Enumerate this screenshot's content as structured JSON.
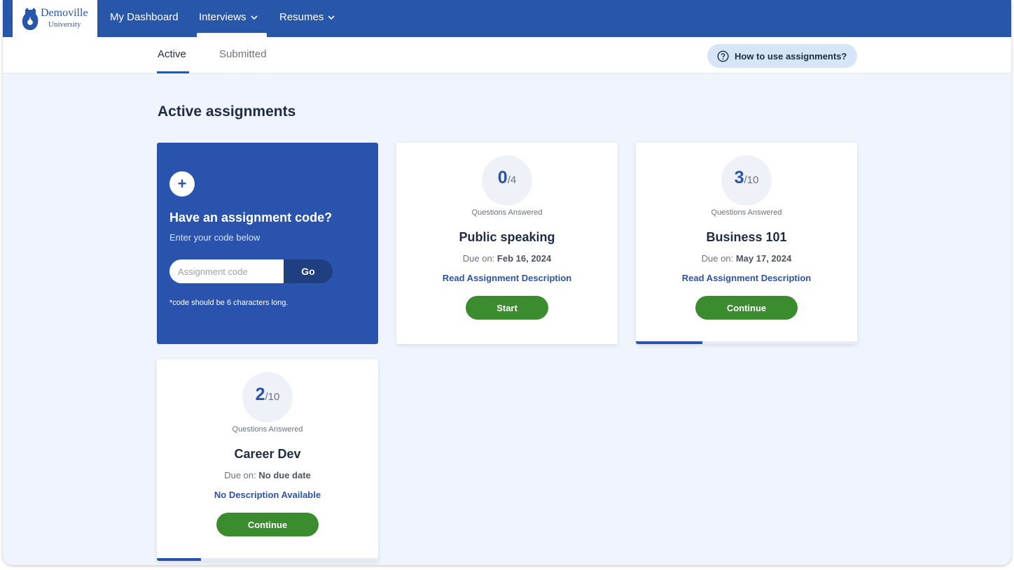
{
  "brand": {
    "name": "Demoville",
    "sub": "University",
    "color": "#2856a8"
  },
  "nav": {
    "dashboard": "My Dashboard",
    "interviews": "Interviews",
    "resumes": "Resumes"
  },
  "tabs": {
    "active": "Active",
    "submitted": "Submitted"
  },
  "help": {
    "label": "How to use assignments?",
    "icon": "question-circle-icon"
  },
  "page_title": "Active assignments",
  "code_card": {
    "title": "Have an assignment code?",
    "subtitle": "Enter your code below",
    "placeholder": "Assignment code",
    "value": "",
    "go_label": "Go",
    "hint": "*code should be 6 characters long.",
    "icon": "plus-icon"
  },
  "assignments": [
    {
      "answered": "0",
      "total": "/4",
      "answered_label": "Questions Answered",
      "title": "Public speaking",
      "due_prefix": "Due on:",
      "due_date": "Feb 16, 2024",
      "description_link": "Read Assignment Description",
      "action": "Start",
      "progress": 0
    },
    {
      "answered": "3",
      "total": "/10",
      "answered_label": "Questions Answered",
      "title": "Business 101",
      "due_prefix": "Due on:",
      "due_date": "May 17, 2024",
      "description_link": "Read Assignment Description",
      "action": "Continue",
      "progress": 0.3
    },
    {
      "answered": "2",
      "total": "/10",
      "answered_label": "Questions Answered",
      "title": "Career Dev",
      "due_prefix": "Due on:",
      "due_date": "No due date",
      "description_link": "No Description Available",
      "action": "Continue",
      "progress": 0.2
    }
  ],
  "colors": {
    "accent": "#2a53ad",
    "action": "#3a8c2e",
    "background": "#f0f4fc"
  }
}
